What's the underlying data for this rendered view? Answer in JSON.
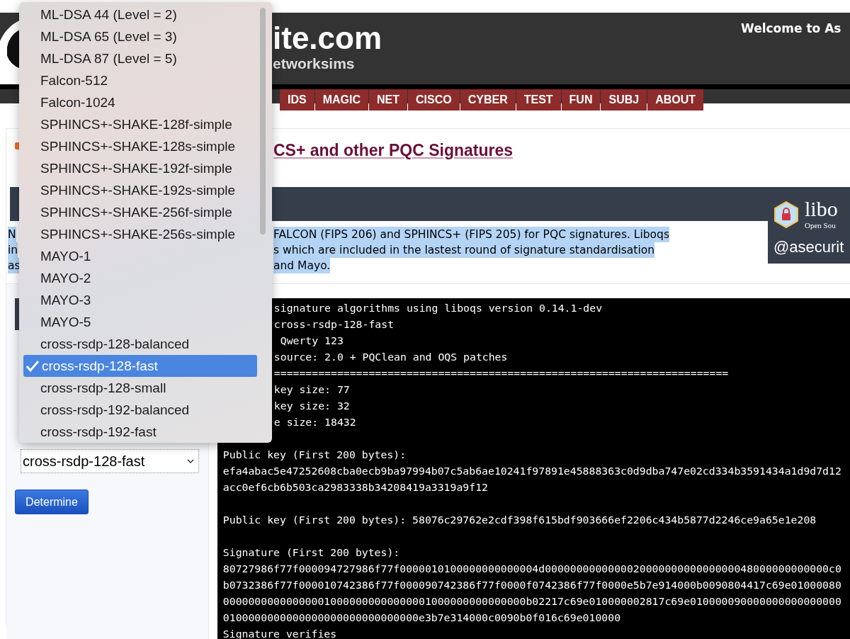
{
  "header": {
    "logo_text": "ite.com",
    "logo_subtext": "etworksims",
    "welcome": "Welcome to As"
  },
  "nav": [
    {
      "label": "IDS"
    },
    {
      "label": "MAGIC"
    },
    {
      "label": "NET"
    },
    {
      "label": "CISCO"
    },
    {
      "label": "CYBER"
    },
    {
      "label": "TEST"
    },
    {
      "label": "FUN"
    },
    {
      "label": "SUBJ"
    },
    {
      "label": "ABOUT"
    }
  ],
  "page_title": "CS+ and other PQC Signatures",
  "intro": {
    "highlighted": true,
    "left_lines": [
      "N",
      "in",
      "as"
    ],
    "right_lines": [
      "FALCON (FIPS 206) and SPHINCS+ (FIPS 205) for PQC signatures. Liboqs",
      "s which are included in the lastest round of signature standardisation",
      "and Mayo."
    ]
  },
  "logo_panel": {
    "name": "libo",
    "tagline": "Open Sou",
    "handle": "@asecurit"
  },
  "form": {
    "select_value": "cross-rsdp-128-fast",
    "button": "Determine"
  },
  "dropdown": {
    "options": [
      {
        "label": "ML-DSA 44 (Level = 2)",
        "selected": false
      },
      {
        "label": "ML-DSA 65 (Level = 3)",
        "selected": false
      },
      {
        "label": "ML-DSA 87 (Level = 5)",
        "selected": false
      },
      {
        "label": "Falcon-512",
        "selected": false
      },
      {
        "label": "Falcon-1024",
        "selected": false
      },
      {
        "label": "SPHINCS+-SHAKE-128f-simple",
        "selected": false
      },
      {
        "label": "SPHINCS+-SHAKE-128s-simple",
        "selected": false
      },
      {
        "label": "SPHINCS+-SHAKE-192f-simple",
        "selected": false
      },
      {
        "label": "SPHINCS+-SHAKE-192s-simple",
        "selected": false
      },
      {
        "label": "SPHINCS+-SHAKE-256f-simple",
        "selected": false
      },
      {
        "label": "SPHINCS+-SHAKE-256s-simple",
        "selected": false
      },
      {
        "label": "MAYO-1",
        "selected": false
      },
      {
        "label": "MAYO-2",
        "selected": false
      },
      {
        "label": "MAYO-3",
        "selected": false
      },
      {
        "label": "MAYO-5",
        "selected": false
      },
      {
        "label": "cross-rsdp-128-balanced",
        "selected": false
      },
      {
        "label": "cross-rsdp-128-fast",
        "selected": true
      },
      {
        "label": "cross-rsdp-128-small",
        "selected": false
      },
      {
        "label": "cross-rsdp-192-balanced",
        "selected": false
      },
      {
        "label": "cross-rsdp-192-fast",
        "selected": false
      }
    ]
  },
  "terminal": {
    "lines": [
      {
        "kind": "partial",
        "text": "signature algorithms using liboqs version 0.14.1-dev"
      },
      {
        "kind": "partial",
        "text": "cross-rsdp-128-fast"
      },
      {
        "kind": "partial",
        "text": " Qwerty 123"
      },
      {
        "kind": "partial",
        "text": "source: 2.0 + PQClean and OQS patches"
      },
      {
        "kind": "partial",
        "text": "========================================================================"
      },
      {
        "kind": "partial",
        "text": "key size: 77"
      },
      {
        "kind": "partial",
        "text": "key size: 32"
      },
      {
        "kind": "partial",
        "text": "e size: 18432"
      },
      {
        "kind": "blank"
      },
      {
        "kind": "full",
        "text": "Public key (First 200 bytes):"
      },
      {
        "kind": "full",
        "text": "efa4abac5e47252608cba0ecb9ba97994b07c5ab6ae10241f97891e45888363c0d9dba747e02cd334b3591434a1d9d7d12"
      },
      {
        "kind": "full",
        "text": "acc0ef6cb6b503ca2983338b34208419a3319a9f12"
      },
      {
        "kind": "blank"
      },
      {
        "kind": "full",
        "text": "Public key (First 200 bytes): 58076c29762e2cdf398f615bdf903666ef2206c434b5877d2246ce9a65e1e208"
      },
      {
        "kind": "blank"
      },
      {
        "kind": "full",
        "text": "Signature (First 200 bytes):"
      },
      {
        "kind": "full",
        "text": "80727986f77f000094727986f77f0000010100000000000004d000000000000002000000000000000048000000000000c0"
      },
      {
        "kind": "full",
        "text": "b0732386f77f000010742386f77f000090742386f77f0000f0742386f77f0000e5b7e914000b0090804417c69e01000080"
      },
      {
        "kind": "full",
        "text": "000000000000000010000000000000001000000000000000b02217c69e010000002817c69e010000090000000000000000"
      },
      {
        "kind": "full",
        "text": "0100000000000000000000000000000e3b7e314000c0090b0f016c69e010000"
      },
      {
        "kind": "full",
        "text": "Signature verifies"
      }
    ]
  }
}
